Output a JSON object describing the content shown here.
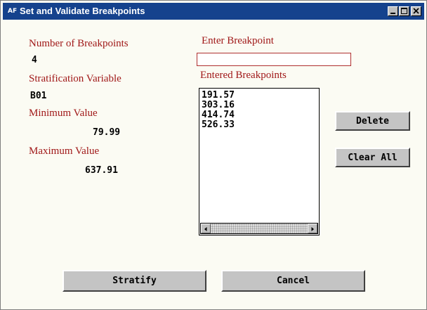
{
  "window": {
    "title": "Set and Validate Breakpoints",
    "app_icon": "AF"
  },
  "form": {
    "num_breakpoints_label": "Number of Breakpoints",
    "num_breakpoints_value": "4",
    "strat_var_label": "Stratification Variable",
    "strat_var_value": "B01",
    "min_label": "Minimum Value",
    "min_value": "79.99",
    "max_label": "Maximum Value",
    "max_value": "637.91",
    "enter_label": "Enter Breakpoint",
    "enter_value": "",
    "entered_label": "Entered Breakpoints",
    "breakpoints": [
      "191.57",
      "303.16",
      "414.74",
      "526.33"
    ]
  },
  "buttons": {
    "delete": "Delete",
    "clear_all": "Clear All",
    "stratify": "Stratify",
    "cancel": "Cancel"
  },
  "colors": {
    "titlebar": "#15428d",
    "label": "#a01818",
    "background": "#fbfbf3",
    "button": "#c4c4c4"
  }
}
